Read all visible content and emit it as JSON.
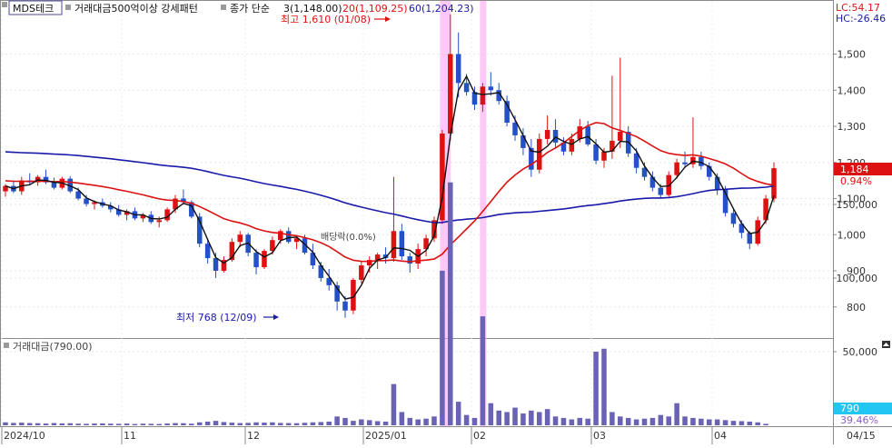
{
  "price_panel": {
    "stock_name": "MDS테크",
    "indicator_label": "거래대금500억이상 강세패턴",
    "ma_title": "종가 단순",
    "ma_items": [
      {
        "label": "3(1,148.00)",
        "color": "#111111"
      },
      {
        "label": "20(1,109.25)",
        "color": "#dd1111"
      },
      {
        "label": "60(1,204.23)",
        "color": "#1a1aaa"
      }
    ],
    "lc_label": "LC:54.17",
    "hc_label": "HC:-26.46",
    "high_annotation": "최고 1,610 (01/08)",
    "low_annotation": "최저 768 (12/09)",
    "zero_label": "배당락(0.0%)",
    "current_price_label": "1,184",
    "current_change_label": "0.94%",
    "colors": {
      "up": "#dd1111",
      "down": "#2450c8",
      "highlight": "#ff9cf0"
    }
  },
  "volume_panel": {
    "title": "거래대금(790.00)",
    "current_label": "790",
    "current_pct_label": "39.46%",
    "bar_color": "#6a62b4",
    "current_label_bg": "#22c6f0"
  },
  "x_axis": {
    "labels": [
      "2024/10",
      "11",
      "12",
      "2025/01",
      "02",
      "03",
      "04",
      "04/15"
    ]
  },
  "chart_data": [
    {
      "type": "candlestick",
      "title": "MDS테크",
      "ylim": [
        700,
        1650
      ],
      "yticks": [
        "800",
        "900",
        "1,000",
        "1,100",
        "1,200",
        "1,300",
        "1,400",
        "1,500"
      ],
      "high": {
        "value": 1610,
        "date": "01/08"
      },
      "low": {
        "value": 768,
        "date": "12/09"
      },
      "ohlc": [
        [
          1120,
          1140,
          1105,
          1135
        ],
        [
          1135,
          1150,
          1115,
          1120
        ],
        [
          1120,
          1160,
          1110,
          1150
        ],
        [
          1150,
          1170,
          1140,
          1145
        ],
        [
          1145,
          1165,
          1135,
          1160
        ],
        [
          1160,
          1180,
          1140,
          1145
        ],
        [
          1145,
          1158,
          1125,
          1130
        ],
        [
          1130,
          1160,
          1125,
          1155
        ],
        [
          1155,
          1162,
          1115,
          1120
        ],
        [
          1120,
          1130,
          1095,
          1100
        ],
        [
          1100,
          1110,
          1078,
          1085
        ],
        [
          1085,
          1095,
          1070,
          1090
        ],
        [
          1090,
          1100,
          1075,
          1080
        ],
        [
          1080,
          1090,
          1062,
          1070
        ],
        [
          1070,
          1082,
          1050,
          1055
        ],
        [
          1055,
          1070,
          1040,
          1065
        ],
        [
          1065,
          1075,
          1040,
          1045
        ],
        [
          1045,
          1060,
          1035,
          1055
        ],
        [
          1055,
          1065,
          1030,
          1035
        ],
        [
          1035,
          1050,
          1020,
          1040
        ],
        [
          1040,
          1075,
          1035,
          1070
        ],
        [
          1070,
          1110,
          1060,
          1100
        ],
        [
          1100,
          1125,
          1085,
          1090
        ],
        [
          1090,
          1095,
          1045,
          1050
        ],
        [
          1050,
          1060,
          965,
          975
        ],
        [
          975,
          990,
          920,
          935
        ],
        [
          935,
          950,
          880,
          900
        ],
        [
          900,
          940,
          895,
          930
        ],
        [
          930,
          990,
          925,
          980
        ],
        [
          980,
          1010,
          965,
          1000
        ],
        [
          1000,
          1005,
          940,
          950
        ],
        [
          950,
          960,
          890,
          910
        ],
        [
          910,
          960,
          905,
          955
        ],
        [
          955,
          995,
          945,
          985
        ],
        [
          985,
          1015,
          975,
          1010
        ],
        [
          1010,
          1020,
          975,
          980
        ],
        [
          980,
          995,
          960,
          990
        ],
        [
          990,
          1000,
          945,
          950
        ],
        [
          950,
          975,
          905,
          915
        ],
        [
          915,
          925,
          870,
          880
        ],
        [
          880,
          905,
          845,
          860
        ],
        [
          860,
          870,
          790,
          815
        ],
        [
          815,
          830,
          770,
          790
        ],
        [
          790,
          880,
          780,
          875
        ],
        [
          875,
          925,
          865,
          915
        ],
        [
          915,
          940,
          895,
          930
        ],
        [
          930,
          950,
          905,
          945
        ],
        [
          945,
          965,
          920,
          935
        ],
        [
          935,
          1160,
          925,
          1010
        ],
        [
          1010,
          1030,
          930,
          940
        ],
        [
          940,
          950,
          895,
          920
        ],
        [
          920,
          975,
          905,
          960
        ],
        [
          960,
          1000,
          940,
          990
        ],
        [
          990,
          1050,
          980,
          1040
        ],
        [
          1040,
          1290,
          1030,
          1280
        ],
        [
          1280,
          1610,
          1260,
          1500
        ],
        [
          1500,
          1560,
          1380,
          1420
        ],
        [
          1420,
          1445,
          1385,
          1395
        ],
        [
          1395,
          1410,
          1345,
          1360
        ],
        [
          1360,
          1420,
          1340,
          1410
        ],
        [
          1410,
          1450,
          1385,
          1400
        ],
        [
          1400,
          1420,
          1360,
          1370
        ],
        [
          1370,
          1385,
          1300,
          1310
        ],
        [
          1310,
          1330,
          1260,
          1275
        ],
        [
          1275,
          1295,
          1220,
          1240
        ],
        [
          1240,
          1265,
          1160,
          1180
        ],
        [
          1180,
          1280,
          1170,
          1265
        ],
        [
          1265,
          1330,
          1250,
          1290
        ],
        [
          1290,
          1320,
          1240,
          1255
        ],
        [
          1255,
          1270,
          1220,
          1230
        ],
        [
          1230,
          1280,
          1220,
          1265
        ],
        [
          1265,
          1320,
          1255,
          1300
        ],
        [
          1300,
          1315,
          1245,
          1250
        ],
        [
          1250,
          1265,
          1195,
          1205
        ],
        [
          1205,
          1240,
          1185,
          1230
        ],
        [
          1230,
          1440,
          1210,
          1260
        ],
        [
          1260,
          1490,
          1240,
          1285
        ],
        [
          1285,
          1300,
          1215,
          1225
        ],
        [
          1225,
          1240,
          1170,
          1185
        ],
        [
          1185,
          1200,
          1150,
          1160
        ],
        [
          1160,
          1175,
          1120,
          1130
        ],
        [
          1130,
          1140,
          1100,
          1110
        ],
        [
          1110,
          1175,
          1105,
          1165
        ],
        [
          1165,
          1210,
          1155,
          1200
        ],
        [
          1200,
          1230,
          1185,
          1195
        ],
        [
          1195,
          1325,
          1185,
          1215
        ],
        [
          1215,
          1230,
          1180,
          1190
        ],
        [
          1190,
          1200,
          1150,
          1160
        ],
        [
          1160,
          1170,
          1110,
          1125
        ],
        [
          1125,
          1135,
          1050,
          1060
        ],
        [
          1060,
          1070,
          1020,
          1030
        ],
        [
          1030,
          1040,
          990,
          1005
        ],
        [
          1005,
          1010,
          960,
          975
        ],
        [
          975,
          1050,
          970,
          1040
        ],
        [
          1040,
          1110,
          1030,
          1100
        ],
        [
          1100,
          1200,
          1090,
          1184
        ]
      ]
    },
    {
      "type": "bar",
      "title": "거래대금(790.00)",
      "ylim": [
        0,
        180000
      ],
      "yticks": [
        "50,000",
        "100,000",
        "150,000"
      ],
      "values": [
        2000,
        1600,
        1800,
        1500,
        1400,
        1200,
        1500,
        1300,
        1400,
        1100,
        1000,
        1200,
        1300,
        1100,
        1000,
        1200,
        900,
        1100,
        1000,
        900,
        1200,
        1500,
        1400,
        1100,
        2000,
        2500,
        3000,
        2200,
        1800,
        1500,
        1600,
        2000,
        1800,
        2000,
        1600,
        1500,
        1400,
        1700,
        2000,
        2200,
        2500,
        6000,
        5000,
        3000,
        4000,
        3500,
        2800,
        2500,
        28000,
        9000,
        5000,
        4000,
        4500,
        6000,
        105000,
        165000,
        16000,
        7000,
        5000,
        74000,
        15000,
        10000,
        9000,
        12000,
        8000,
        10000,
        9000,
        11000,
        6000,
        5000,
        4000,
        5000,
        4500,
        50000,
        52000,
        9000,
        6000,
        5000,
        4000,
        4500,
        5000,
        7000,
        6000,
        15000,
        6000,
        5000,
        4500,
        4000,
        4000,
        3500,
        3000,
        2800,
        2500,
        2000,
        1000
      ]
    }
  ]
}
